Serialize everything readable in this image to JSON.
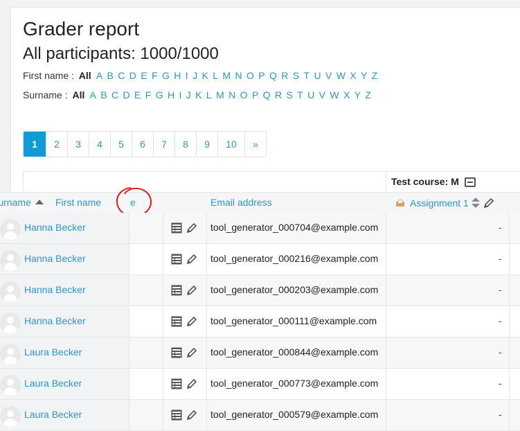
{
  "header": {
    "title": "Grader report",
    "subtitle": "All participants: 1000/1000"
  },
  "firstname_filter": {
    "label": "First name :",
    "all": "All",
    "letters": [
      "A",
      "B",
      "C",
      "D",
      "E",
      "F",
      "G",
      "H",
      "I",
      "J",
      "K",
      "L",
      "M",
      "N",
      "O",
      "P",
      "Q",
      "R",
      "S",
      "T",
      "U",
      "V",
      "W",
      "X",
      "Y",
      "Z"
    ]
  },
  "surname_filter": {
    "label": "Surname :",
    "all": "All",
    "letters": [
      "A",
      "B",
      "C",
      "D",
      "E",
      "F",
      "G",
      "H",
      "I",
      "J",
      "K",
      "L",
      "M",
      "N",
      "O",
      "P",
      "Q",
      "R",
      "S",
      "T",
      "U",
      "V",
      "W",
      "X",
      "Y",
      "Z"
    ]
  },
  "pagination": {
    "pages": [
      "1",
      "2",
      "3",
      "4",
      "5",
      "6",
      "7",
      "8",
      "9",
      "10"
    ],
    "active": "1",
    "next": "»"
  },
  "table": {
    "course_header": "Test course: M",
    "columns": {
      "surname": "Surname",
      "firstname": "First name",
      "extra": "e",
      "email": "Email address",
      "assignment": "Assignment 1"
    },
    "rows": [
      {
        "name": "Hanna Becker",
        "email": "tool_generator_000704@example.com",
        "grade": "-"
      },
      {
        "name": "Hanna Becker",
        "email": "tool_generator_000216@example.com",
        "grade": "-"
      },
      {
        "name": "Hanna Becker",
        "email": "tool_generator_000203@example.com",
        "grade": "-"
      },
      {
        "name": "Hanna Becker",
        "email": "tool_generator_000111@example.com",
        "grade": "-"
      },
      {
        "name": "Laura Becker",
        "email": "tool_generator_000844@example.com",
        "grade": "-"
      },
      {
        "name": "Laura Becker",
        "email": "tool_generator_000773@example.com",
        "grade": "-"
      },
      {
        "name": "Laura Becker",
        "email": "tool_generator_000579@example.com",
        "grade": "-"
      }
    ]
  },
  "colors": {
    "link": "#2a97c7",
    "active_page": "#0f9bd7",
    "annotation": "#e0201e"
  },
  "icons": {
    "grades_icon": "table-grid-icon",
    "edit_icon": "pencil-icon",
    "assignment_icon": "assignment-icon",
    "sort_icon": "sort-arrow-icon"
  }
}
